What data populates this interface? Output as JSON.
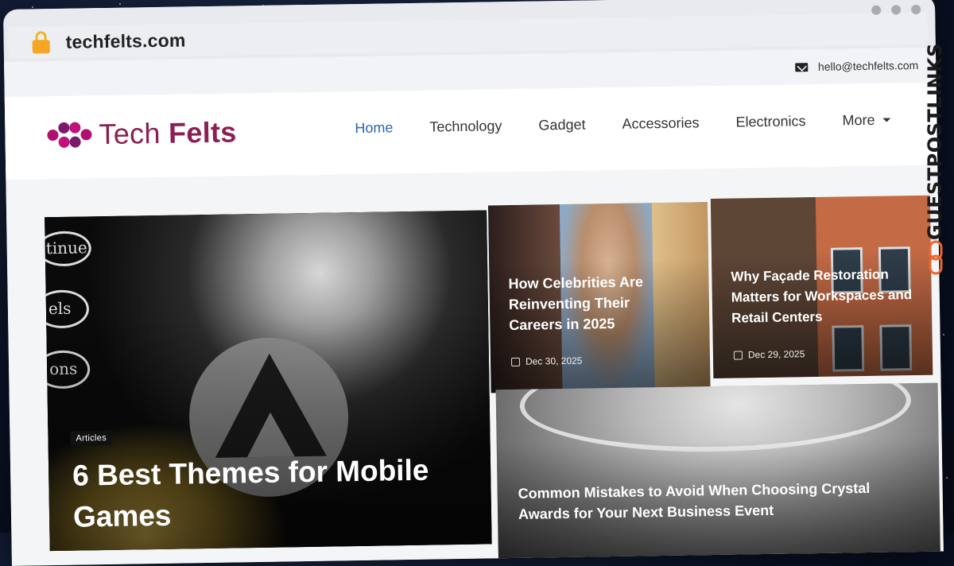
{
  "browser": {
    "url": "techfelts.com"
  },
  "topbar": {
    "email": "hello@techfelts.com"
  },
  "logo": {
    "part1": "Tech ",
    "part2": "Felts",
    "colors": {
      "brand": "#8b1f54",
      "accent": "#c0127a"
    }
  },
  "nav": {
    "items": [
      {
        "label": "Home",
        "active": true
      },
      {
        "label": "Technology"
      },
      {
        "label": "Gadget"
      },
      {
        "label": "Accessories"
      },
      {
        "label": "Electronics"
      },
      {
        "label": "More"
      }
    ]
  },
  "articles": {
    "featured": {
      "tag": "Articles",
      "title": "6 Best Themes for Mobile Games",
      "rings": [
        "tinue",
        "els",
        "ons"
      ]
    },
    "celebrities": {
      "title": "How Celebrities Are Reinventing Their Careers in 2025",
      "date": "Dec 30, 2025"
    },
    "facade": {
      "title": "Why Façade Restoration Matters for Workspaces and Retail Centers",
      "date": "Dec 29, 2025"
    },
    "crystal": {
      "title": "Common Mistakes to Avoid When Choosing Crystal Awards for Your Next Business Event"
    }
  },
  "side_badge": {
    "text": "GUESTPOSTLINKS",
    "link_color": "#f0642d"
  }
}
